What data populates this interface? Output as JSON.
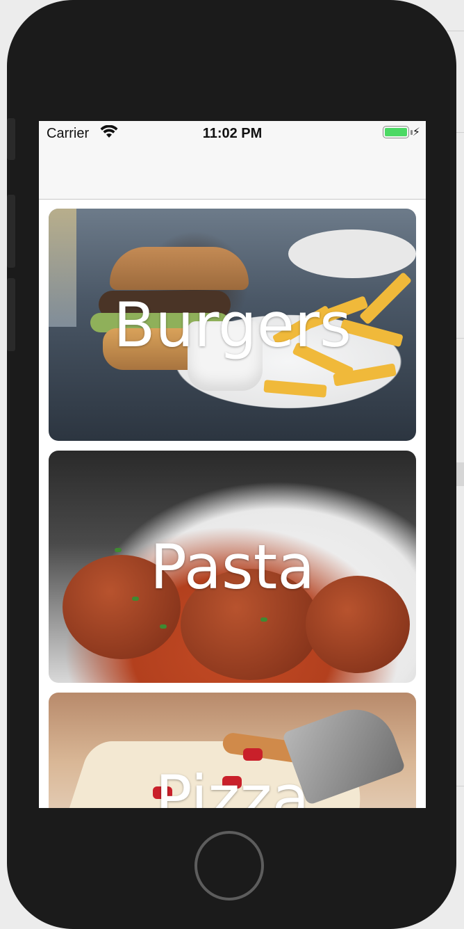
{
  "status_bar": {
    "carrier": "Carrier",
    "time": "11:02 PM",
    "battery_level": 1.0,
    "battery_color": "#4cd964",
    "icons": [
      "wifi-icon",
      "battery-icon",
      "charging-bolt-icon"
    ]
  },
  "nav_bar": {
    "title": ""
  },
  "cards": [
    {
      "title": "Burgers",
      "image": "burger-and-fries-photo"
    },
    {
      "title": "Pasta",
      "image": "pasta-with-meatballs-photo"
    },
    {
      "title": "Pizza",
      "image": "pizza-slice-photo"
    }
  ],
  "device": {
    "home_button_icon": "home-button-icon"
  }
}
